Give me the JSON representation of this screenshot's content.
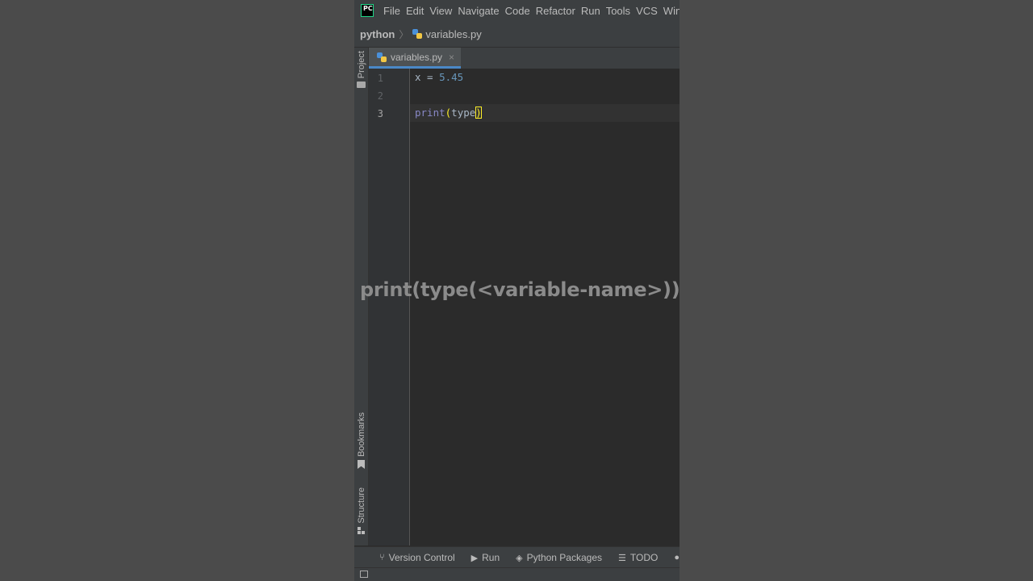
{
  "menubar": {
    "app_icon": "pycharm-logo",
    "app_icon_text": "PC",
    "items": [
      "File",
      "Edit",
      "View",
      "Navigate",
      "Code",
      "Refactor",
      "Run",
      "Tools",
      "VCS",
      "Wind"
    ]
  },
  "navbar": {
    "project": "python",
    "file": "variables.py"
  },
  "left_strip": {
    "project": "Project",
    "bookmarks": "Bookmarks",
    "structure": "Structure"
  },
  "tab": {
    "label": "variables.py",
    "close": "×"
  },
  "editor": {
    "line_numbers": [
      "1",
      "2",
      "3"
    ],
    "line1": {
      "var": "x",
      "op": " = ",
      "value": "5.45"
    },
    "line3": {
      "func": "print",
      "open_paren": "(",
      "inner": "type",
      "close_paren": ")"
    }
  },
  "overlay": {
    "caption": "print(type(<variable-name>))"
  },
  "bottom_bar": {
    "version_control": "Version Control",
    "run": "Run",
    "python_packages": "Python Packages",
    "todo": "TODO"
  },
  "colors": {
    "editor_bg": "#2b2b2b",
    "chrome_bg": "#3c3f41",
    "number": "#6897bb",
    "builtin": "#8888c6",
    "paren_match": "#ffef28"
  }
}
